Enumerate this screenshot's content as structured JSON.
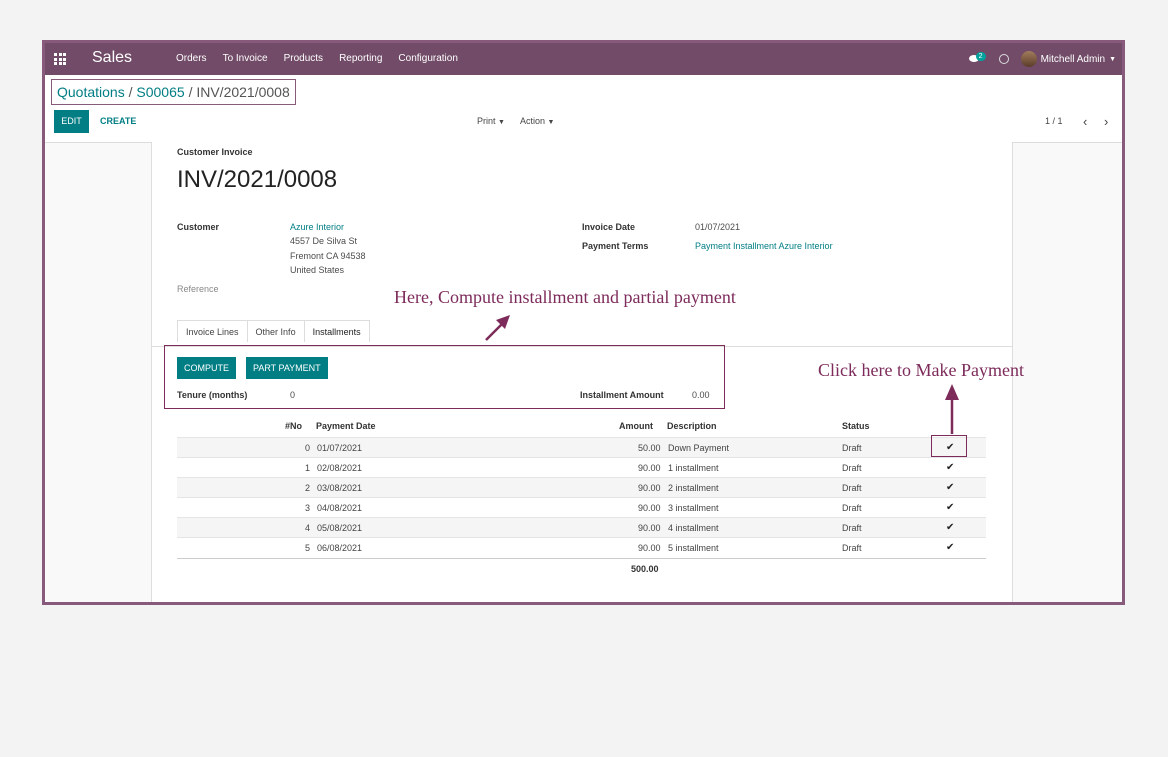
{
  "navbar": {
    "app_title": "Sales",
    "menu": [
      "Orders",
      "To Invoice",
      "Products",
      "Reporting",
      "Configuration"
    ],
    "messages_count": "2",
    "user_name": "Mitchell Admin"
  },
  "breadcrumb": {
    "link1": "Quotations",
    "sep1": "/",
    "link2": "S00065",
    "sep2": "/",
    "current": "INV/2021/0008"
  },
  "control": {
    "edit_label": "EDIT",
    "create_label": "CREATE",
    "print_label": "Print",
    "action_label": "Action",
    "pager": "1 / 1"
  },
  "invoice": {
    "type_label": "Customer Invoice",
    "number": "INV/2021/0008",
    "customer_label": "Customer",
    "customer_name": "Azure Interior",
    "address_line1": "4557 De Silva St",
    "address_line2": "Fremont CA 94538",
    "address_line3": "United States",
    "reference_label": "Reference",
    "invoice_date_label": "Invoice Date",
    "invoice_date": "01/07/2021",
    "payment_terms_label": "Payment Terms",
    "payment_terms": "Payment Installment Azure Interior"
  },
  "tabs": [
    "Invoice Lines",
    "Other Info",
    "Installments"
  ],
  "installments": {
    "compute_label": "COMPUTE",
    "part_payment_label": "PART PAYMENT",
    "tenure_label": "Tenure (months)",
    "tenure_value": "0",
    "installment_amount_label": "Installment Amount",
    "installment_amount_value": "0.00",
    "columns": {
      "no": "#No",
      "date": "Payment Date",
      "amount": "Amount",
      "description": "Description",
      "status": "Status"
    },
    "rows": [
      {
        "no": "0",
        "date": "01/07/2021",
        "amount": "50.00",
        "description": "Down Payment",
        "status": "Draft"
      },
      {
        "no": "1",
        "date": "02/08/2021",
        "amount": "90.00",
        "description": "1 installment",
        "status": "Draft"
      },
      {
        "no": "2",
        "date": "03/08/2021",
        "amount": "90.00",
        "description": "2 installment",
        "status": "Draft"
      },
      {
        "no": "3",
        "date": "04/08/2021",
        "amount": "90.00",
        "description": "3 installment",
        "status": "Draft"
      },
      {
        "no": "4",
        "date": "05/08/2021",
        "amount": "90.00",
        "description": "4 installment",
        "status": "Draft"
      },
      {
        "no": "5",
        "date": "06/08/2021",
        "amount": "90.00",
        "description": "5 installment",
        "status": "Draft"
      }
    ],
    "total": "500.00"
  },
  "annotations": {
    "compute_note": "Here, Compute installment and partial payment",
    "payment_note": "Click here to Make Payment",
    "color": "#7d2b5a"
  }
}
